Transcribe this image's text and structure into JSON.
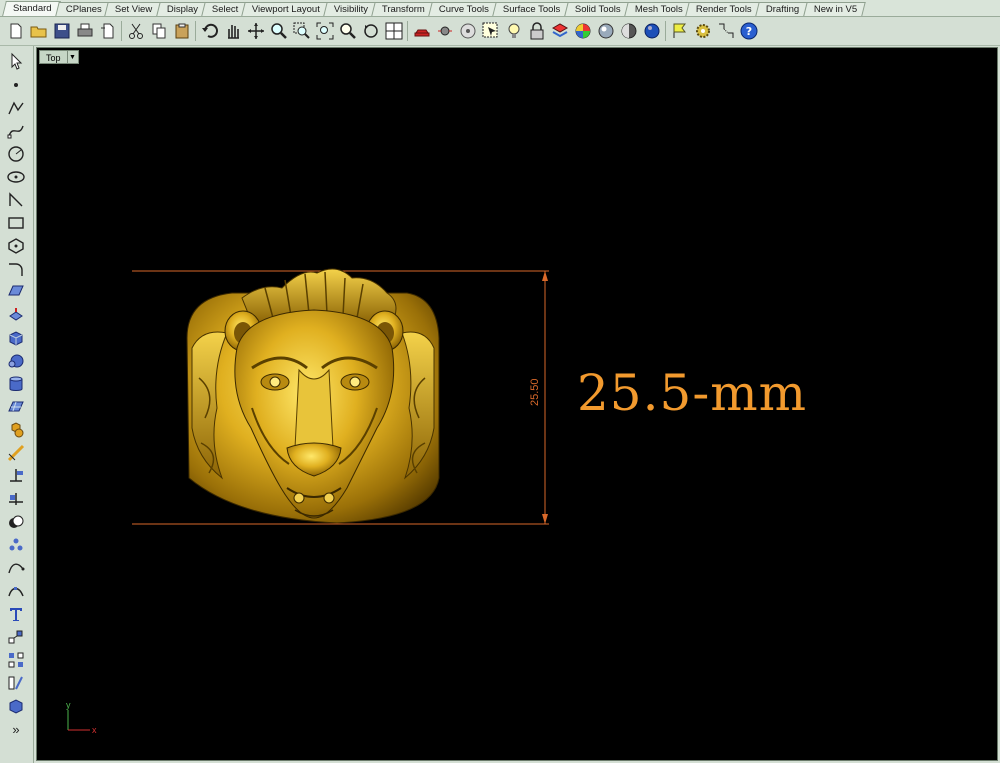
{
  "tabs": [
    {
      "label": "Standard"
    },
    {
      "label": "CPlanes"
    },
    {
      "label": "Set View"
    },
    {
      "label": "Display"
    },
    {
      "label": "Select"
    },
    {
      "label": "Viewport Layout"
    },
    {
      "label": "Visibility"
    },
    {
      "label": "Transform"
    },
    {
      "label": "Curve Tools"
    },
    {
      "label": "Surface Tools"
    },
    {
      "label": "Solid Tools"
    },
    {
      "label": "Mesh Tools"
    },
    {
      "label": "Render Tools"
    },
    {
      "label": "Drafting"
    },
    {
      "label": "New in V5"
    }
  ],
  "viewport": {
    "name": "Top",
    "dimension_value": "25.50",
    "annotation": "25.5-mm",
    "axis_x": "x",
    "axis_y": "y"
  },
  "colors": {
    "dimension": "#f29a2e",
    "gold": "#d4a017",
    "background": "#000000"
  },
  "left_toolbar": {
    "more_label": "»"
  }
}
